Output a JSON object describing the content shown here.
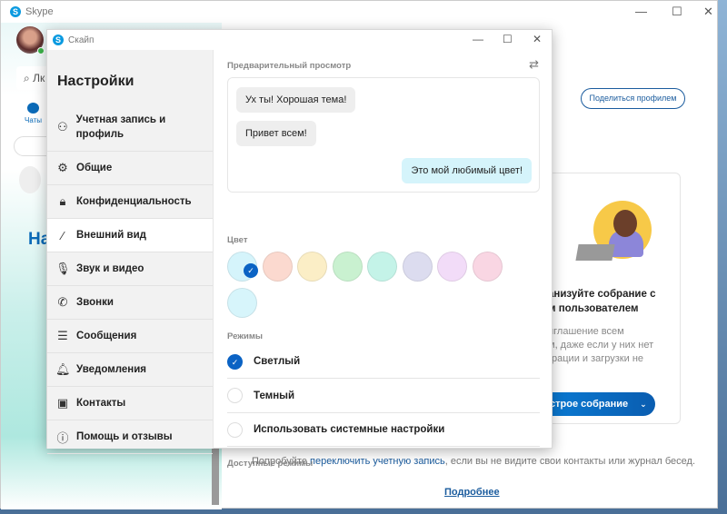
{
  "main_window": {
    "title": "Skype",
    "search_placeholder": "Лк",
    "chats_label": "Чаты",
    "heading_partial": "На",
    "share_profile": "Поделиться профилем",
    "card": {
      "title": "анизуйте собрание с\nм пользователем",
      "description": "иглашение всем\nм, даже если у них нет\nграции и загрузки не",
      "button": "строе собрание"
    },
    "footer": {
      "before": "Попробуйте ",
      "link": "переключить учетную запись",
      "after": ", если вы не видите свои контакты или журнал бесед.",
      "more": "Подробнее"
    }
  },
  "dialog": {
    "title": "Скайп",
    "heading": "Настройки",
    "nav": [
      {
        "label": "Учетная запись и профиль",
        "icon": "person-icon"
      },
      {
        "label": "Общие",
        "icon": "gear-icon"
      },
      {
        "label": "Конфиденциальность",
        "icon": "lock-icon"
      },
      {
        "label": "Внешний вид",
        "icon": "magic-wand-icon",
        "active": true
      },
      {
        "label": "Звук и видео",
        "icon": "microphone-icon"
      },
      {
        "label": "Звонки",
        "icon": "phone-icon"
      },
      {
        "label": "Сообщения",
        "icon": "chat-icon"
      },
      {
        "label": "Уведомления",
        "icon": "bell-icon"
      },
      {
        "label": "Контакты",
        "icon": "contacts-icon"
      },
      {
        "label": "Помощь и отзывы",
        "icon": "info-icon"
      }
    ],
    "preview_label": "Предварительный просмотр",
    "messages": [
      "Ух ты! Хорошая тема!",
      "Привет всем!",
      "Это мой любимый цвет!"
    ],
    "color_label": "Цвет",
    "colors": [
      "#d5f4fb",
      "#fbd9cf",
      "#fbeec6",
      "#c9f1d0",
      "#c4f3e8",
      "#dcdcef",
      "#f2dcf8",
      "#f9d6e3",
      "#d7f5fb"
    ],
    "selected_color": 0,
    "modes_label": "Режимы",
    "modes": [
      {
        "label": "Светлый",
        "selected": true
      },
      {
        "label": "Темный",
        "selected": false
      },
      {
        "label": "Использовать системные настройки",
        "selected": false
      }
    ],
    "available_modes_label": "Доступные режимы"
  }
}
